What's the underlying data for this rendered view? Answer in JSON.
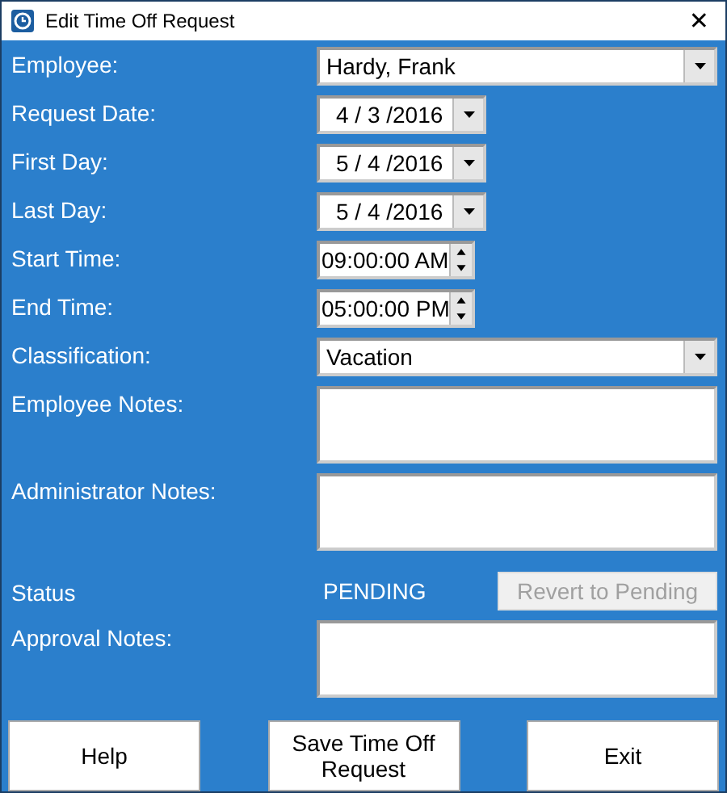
{
  "window": {
    "title": "Edit Time Off Request",
    "close": "✕"
  },
  "fields": [
    {
      "kind": "combo",
      "label": "Employee:",
      "value": "Hardy, Frank"
    },
    {
      "kind": "date",
      "label": "Request Date:",
      "value": "4 / 3 /2016"
    },
    {
      "kind": "date",
      "label": "First Day:",
      "value": "5 / 4 /2016"
    },
    {
      "kind": "date",
      "label": "Last Day:",
      "value": "5 / 4 /2016"
    },
    {
      "kind": "time",
      "label": "Start Time:",
      "value": "09:00:00 AM"
    },
    {
      "kind": "time",
      "label": "End Time:",
      "value": "05:00:00 PM"
    },
    {
      "kind": "combo",
      "label": "Classification:",
      "value": "Vacation"
    },
    {
      "kind": "notes",
      "label": "Employee Notes:"
    },
    {
      "kind": "notes",
      "label": "Administrator Notes:"
    },
    {
      "kind": "status",
      "label": "Status",
      "value": "PENDING",
      "button": {
        "label": "Revert to Pending",
        "disabled": true
      }
    },
    {
      "kind": "notes",
      "label": "Approval Notes:"
    }
  ],
  "buttons": [
    "Help",
    "Save Time Off Request",
    "Exit"
  ]
}
